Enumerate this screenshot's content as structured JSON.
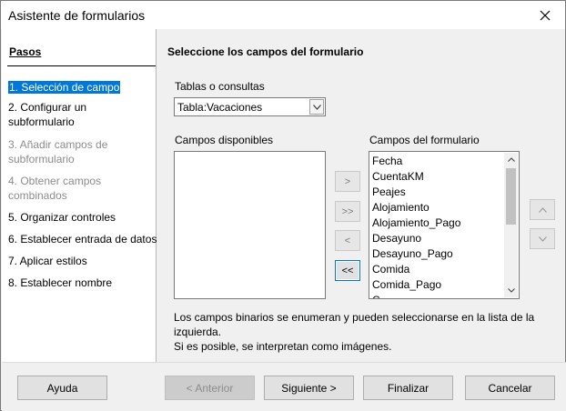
{
  "window": {
    "title": "Asistente de formularios"
  },
  "steps": {
    "title": "Pasos",
    "items": [
      {
        "label": "1. Selección de campo",
        "state": "selected"
      },
      {
        "label": "2. Configurar un",
        "label2": "subformulario",
        "state": "normal"
      },
      {
        "label": "3. Añadir campos de",
        "label2": "subformulario",
        "state": "disabled"
      },
      {
        "label": "4. Obtener campos",
        "label2": "combinados",
        "state": "disabled"
      },
      {
        "label": "5. Organizar controles",
        "state": "normal"
      },
      {
        "label": "6. Establecer entrada de datos",
        "state": "normal"
      },
      {
        "label": "7. Aplicar estilos",
        "state": "normal"
      },
      {
        "label": "8. Establecer nombre",
        "state": "normal"
      }
    ]
  },
  "main": {
    "heading": "Seleccione los campos del formulario",
    "tables_label": "Tablas o consultas",
    "tables_value": "Tabla:Vacaciones",
    "available_label": "Campos disponibles",
    "available_items": [],
    "form_fields_label": "Campos del formulario",
    "form_fields_items": [
      "Fecha",
      "CuentaKM",
      "Peajes",
      "Alojamiento",
      "Alojamiento_Pago",
      "Desayuno",
      "Desayuno_Pago",
      "Comida",
      "Comida_Pago",
      "C"
    ],
    "move_buttons": {
      "add": ">",
      "add_all": ">>",
      "remove": "<",
      "remove_all": "<<"
    },
    "order_buttons": {
      "up": "^",
      "down": "v"
    },
    "info_line1": "Los campos binarios se enumeran y pueden seleccionarse en la lista de la",
    "info_line2": "izquierda.",
    "info_line3": "Si es posible, se interpretan como imágenes."
  },
  "footer": {
    "help": "Ayuda",
    "back": "< Anterior",
    "next": "Siguiente >",
    "finish": "Finalizar",
    "cancel": "Cancelar"
  },
  "colors": {
    "selection": "#0078d7",
    "disabled_text": "#8c8c8c"
  }
}
